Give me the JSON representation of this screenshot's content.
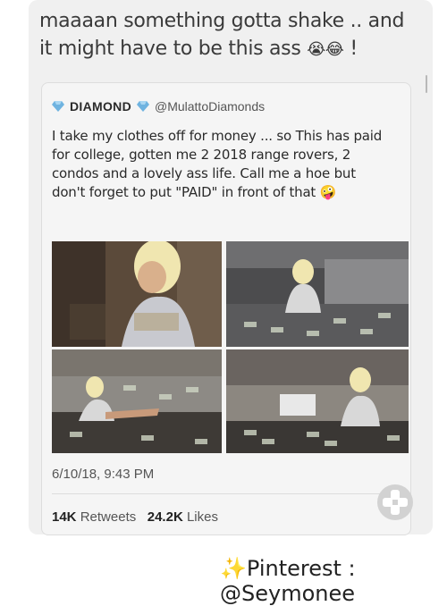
{
  "caption": {
    "text": "maaaan something gotta shake .. and it might have to be this ass",
    "emojis": "😭😂",
    "trailing": "!"
  },
  "tweet": {
    "display_name": "DIAMOND",
    "handle": "@MulattoDiamonds",
    "body": "I take my clothes off for money ... so This has paid for college, gotten me 2 2018 range rovers, 2 condos and a lovely ass life. Call me a hoe but don't forget to put \"PAID\" in front of that",
    "body_emoji": "🤪",
    "timestamp": "6/10/18, 9:43 PM",
    "retweets_count": "14K",
    "retweets_label": "Retweets",
    "likes_count": "24.2K",
    "likes_label": "Likes",
    "gem_color": "#6fb3e0"
  },
  "footer": {
    "text": "✨Pinterest : @Seymonee"
  }
}
